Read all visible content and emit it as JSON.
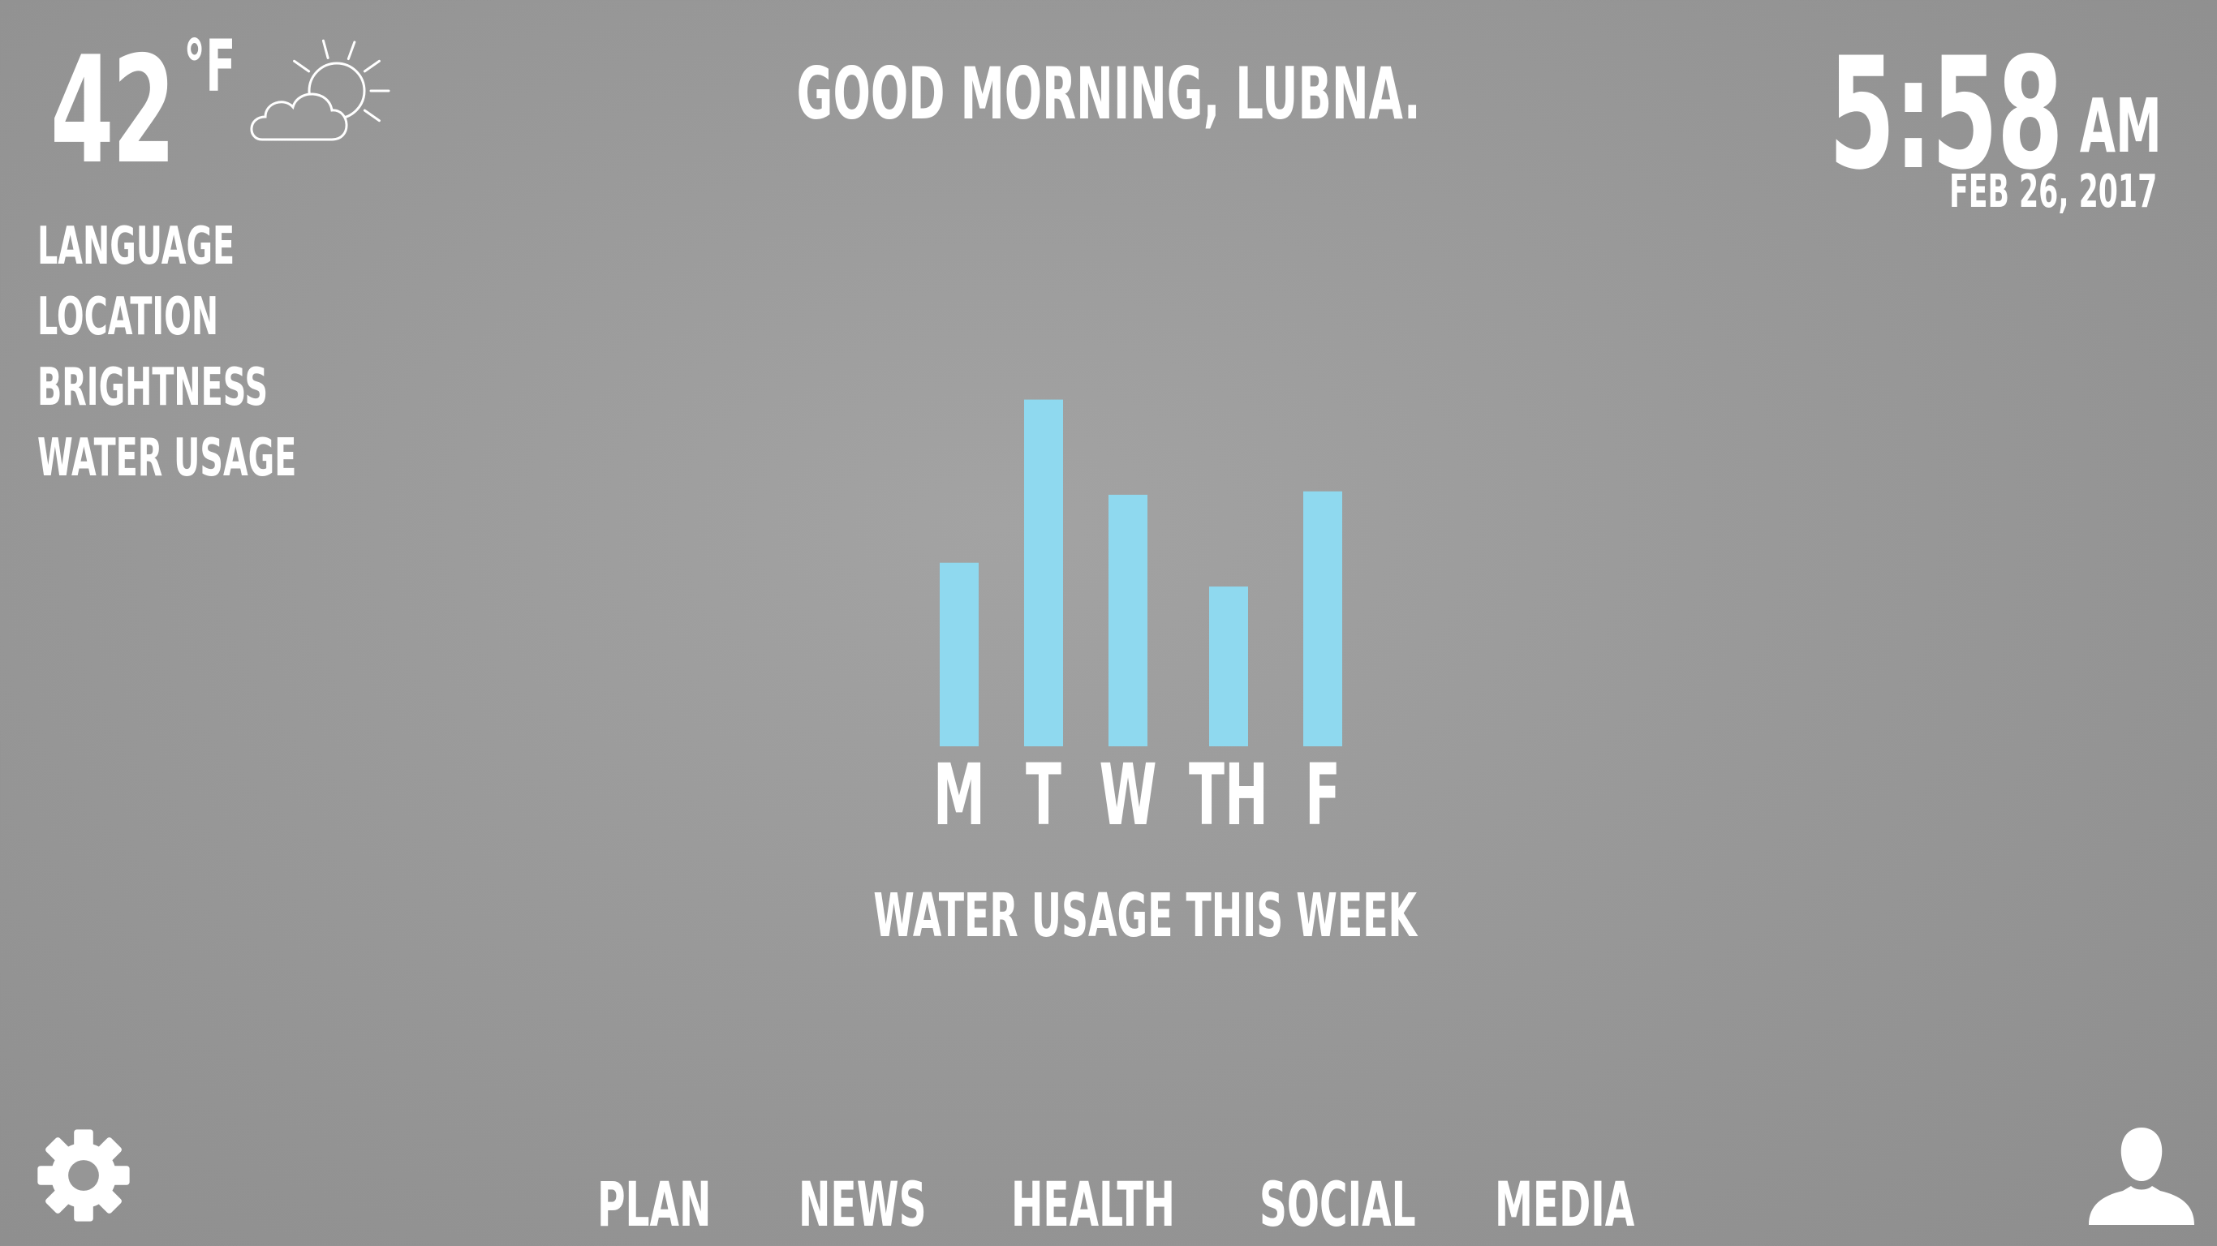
{
  "weather": {
    "temperature": "42",
    "unit": "°F",
    "icon": "partly-cloudy-icon"
  },
  "greeting": "GOOD MORNING, LUBNA.",
  "clock": {
    "time": "5:58",
    "ampm": "AM",
    "date": "FEB 26, 2017"
  },
  "settings_menu": {
    "items": [
      {
        "label": "LANGUAGE"
      },
      {
        "label": "LOCATION"
      },
      {
        "label": "BRIGHTNESS"
      },
      {
        "label": "WATER USAGE"
      }
    ]
  },
  "chart_data": {
    "type": "bar",
    "categories": [
      "M",
      "T",
      "W",
      "TH",
      "F"
    ],
    "values": [
      5.4,
      10.2,
      7.4,
      4.7,
      7.5
    ],
    "ylim": [
      0,
      10.5
    ],
    "title": "WATER USAGE THIS WEEK",
    "bar_color": "#8fd9ef",
    "grid": false
  },
  "nav": {
    "items": [
      {
        "label": "PLAN"
      },
      {
        "label": "NEWS"
      },
      {
        "label": "HEALTH"
      },
      {
        "label": "SOCIAL"
      },
      {
        "label": "MEDIA"
      }
    ]
  },
  "icons": {
    "settings": "gear-icon",
    "profile": "user-icon"
  }
}
